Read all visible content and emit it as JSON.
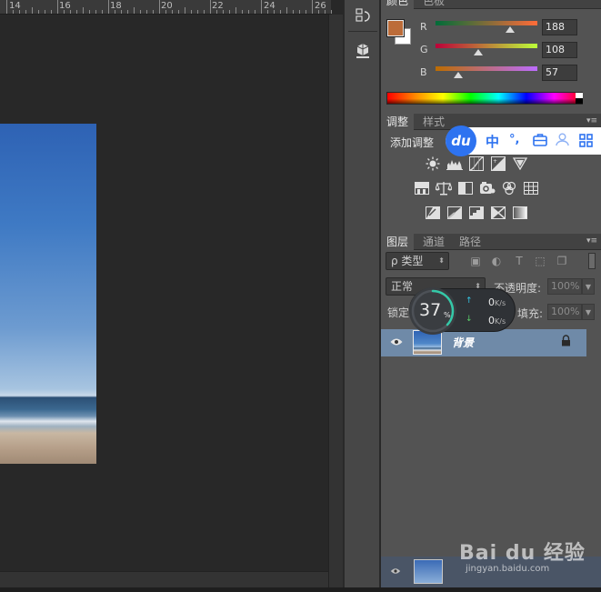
{
  "ruler": {
    "labels": [
      "14",
      "16",
      "18",
      "20",
      "22",
      "24",
      "26"
    ]
  },
  "color_panel": {
    "tabs": [
      "颜色",
      "色板"
    ],
    "foreground_hex": "#bc6c39",
    "background_hex": "#ffffff",
    "channels": [
      {
        "label": "R",
        "value": "188"
      },
      {
        "label": "G",
        "value": "108"
      },
      {
        "label": "B",
        "value": "57"
      }
    ]
  },
  "adjustments_panel": {
    "tabs": [
      "调整",
      "样式"
    ],
    "title": "添加调整"
  },
  "ime_bar": {
    "logo": "du",
    "items": [
      "中",
      "°,"
    ]
  },
  "layers_panel": {
    "tabs": [
      "图层",
      "通道",
      "路径"
    ],
    "filter_label": "ρ 类型",
    "blend_mode": "正常",
    "opacity_label": "不透明度:",
    "opacity_value": "100%",
    "lock_label": "锁定",
    "fill_label": "填充:",
    "fill_value": "100%",
    "layer_name": "背景"
  },
  "net_widget": {
    "percent": "37",
    "percent_sign": "%",
    "up_speed": "0",
    "down_speed": "0",
    "unit": "K/s"
  },
  "watermark": {
    "brand": "Bai du 经验",
    "url": "jingyan.baidu.com"
  }
}
